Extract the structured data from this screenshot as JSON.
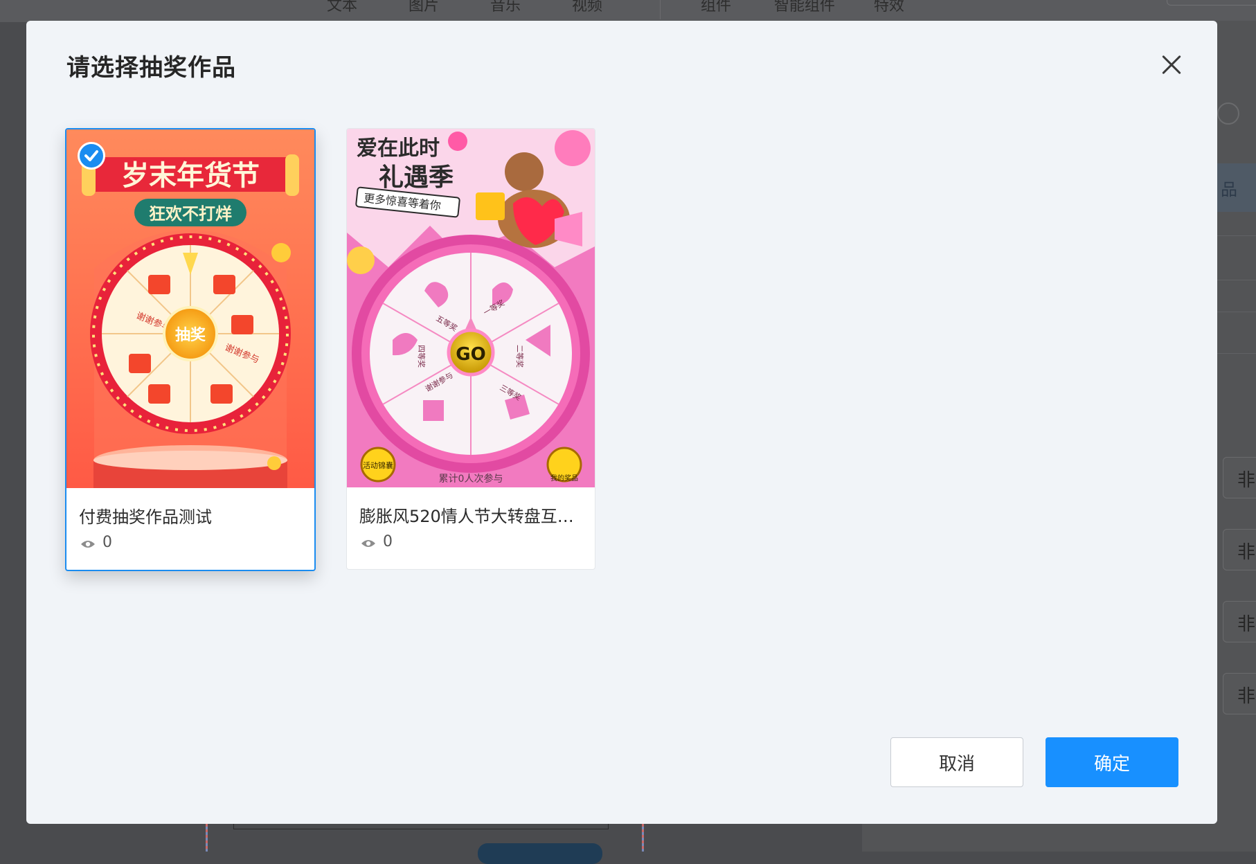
{
  "toolbar": {
    "items": [
      "文本",
      "图片",
      "音乐",
      "视频",
      "组件",
      "智能组件",
      "特效"
    ]
  },
  "right_panel": {
    "tab_fragment": "品",
    "field_fragment": "非"
  },
  "dialog": {
    "title": "请选择抽奖作品",
    "close_icon": "close-icon",
    "cancel_label": "取消",
    "confirm_label": "确定",
    "accent_color": "#1890ff"
  },
  "works": [
    {
      "title": "付费抽奖作品测试",
      "views": "0",
      "selected": true,
      "banner": "岁末年货节",
      "slogan": "狂欢不打烊",
      "wheel_center": "抽奖",
      "segment_labels": [
        "谢谢参与",
        "谢谢参与"
      ]
    },
    {
      "title": "膨胀风520情人节大转盘互…",
      "views": "0",
      "selected": false,
      "headline1": "爱在此时",
      "headline2": "礼遇季",
      "subtitle": "更多惊喜等着你",
      "wheel_center": "GO",
      "segment_labels": [
        "五等奖",
        "一等奖",
        "二等奖",
        "三等奖",
        "谢谢参与",
        "四等奖"
      ],
      "left_button": "活动锦囊",
      "right_button": "我的奖品",
      "footer": "累计0人次参与"
    }
  ]
}
